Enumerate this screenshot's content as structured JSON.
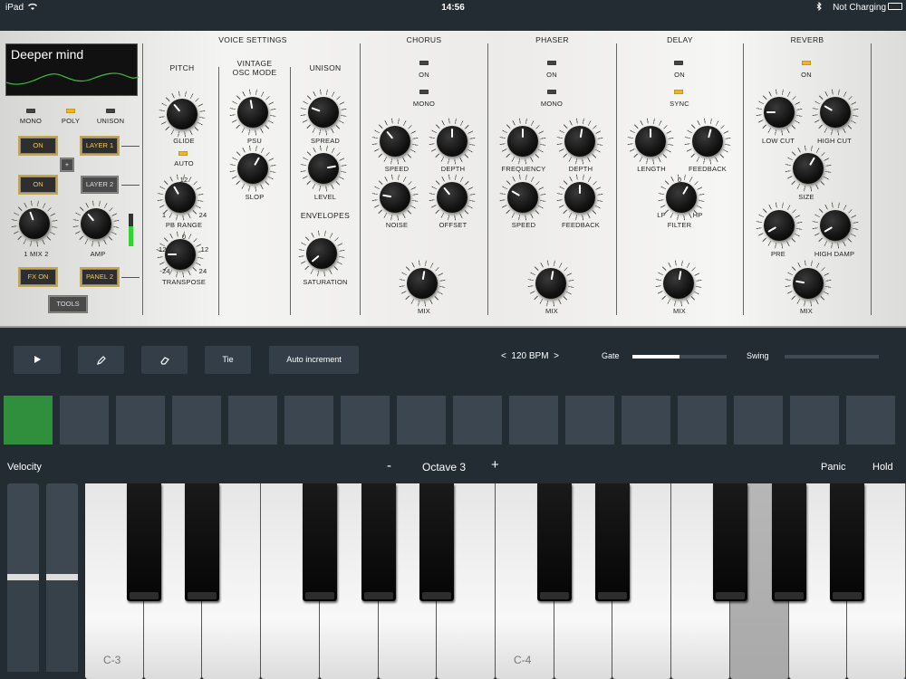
{
  "status": {
    "device": "iPad",
    "time": "14:56",
    "battery": "Not Charging"
  },
  "display": {
    "preset": "Deeper mind"
  },
  "sections": {
    "voice_settings": "VOICE SETTINGS",
    "pitch": "PITCH",
    "vintage": "VINTAGE",
    "osc_mode": "OSC MODE",
    "unison": "UNISON",
    "envelopes": "ENVELOPES",
    "chorus": "CHORUS",
    "phaser": "PHASER",
    "delay": "DELAY",
    "reverb": "REVERB"
  },
  "labels": {
    "mono": "MONO",
    "poly": "POLY",
    "unison": "UNISON",
    "glide": "GLIDE",
    "auto": "AUTO",
    "pb_12": "12",
    "pb_1": "1",
    "pb_24": "24",
    "pb_range": "PB RANGE",
    "tr_0": "0",
    "tr_m12": "-12",
    "tr_12": "12",
    "tr_m24": "-24",
    "tr_24": "24",
    "transpose": "TRANSPOSE",
    "psu": "PSU",
    "slop": "SLOP",
    "spread": "SPREAD",
    "level": "LEVEL",
    "saturation": "SATURATION",
    "mix2": "1 MIX 2",
    "amp": "AMP",
    "ch_on": "ON",
    "ch_mono": "MONO",
    "ch_speed": "SPEED",
    "ch_depth": "DEPTH",
    "ch_noise": "NOISE",
    "ch_offset": "OFFSET",
    "ch_mix": "MIX",
    "ph_on": "ON",
    "ph_mono": "MONO",
    "ph_frequency": "FREQUENCY",
    "ph_depth": "DEPTH",
    "ph_speed": "SPEED",
    "ph_feedback": "FEEDBACK",
    "ph_mix": "MIX",
    "dl_on": "ON",
    "dl_sync": "SYNC",
    "dl_length": "LENGTH",
    "dl_feedback": "FEEDBACK",
    "dl_0": "0",
    "dl_lp": "LP",
    "dl_hp": "HP",
    "dl_filter": "FILTER",
    "dl_mix": "MIX",
    "rv_on": "ON",
    "rv_lowcut": "LOW CUT",
    "rv_highcut": "HIGH CUT",
    "rv_size": "SIZE",
    "rv_pre": "PRE",
    "rv_highdamp": "HIGH DAMP",
    "rv_mix": "MIX"
  },
  "buttons": {
    "on1": "ON",
    "layer1": "LAYER 1",
    "plus": "+",
    "on2": "ON",
    "layer2": "LAYER 2",
    "fx_on": "FX ON",
    "panel2": "PANEL 2",
    "tools": "TOOLS"
  },
  "sequencer": {
    "tie": "Tie",
    "auto_increment": "Auto increment",
    "bpm": "<  120 BPM  >",
    "gate": "Gate",
    "swing": "Swing",
    "gate_value": 0.5,
    "swing_value": 0.0,
    "steps": 16,
    "active_step": 0
  },
  "keyboard": {
    "velocity": "Velocity",
    "octave_minus": "-",
    "octave": "Octave 3",
    "octave_plus": "+",
    "panic": "Panic",
    "hold": "Hold",
    "c3": "C-3",
    "c4": "C-4",
    "velocity_levels": [
      0.5,
      0.5
    ]
  },
  "colors": {
    "accent_led": "#f2b51a",
    "active_step": "#2f8f3c",
    "background": "#232b33"
  }
}
